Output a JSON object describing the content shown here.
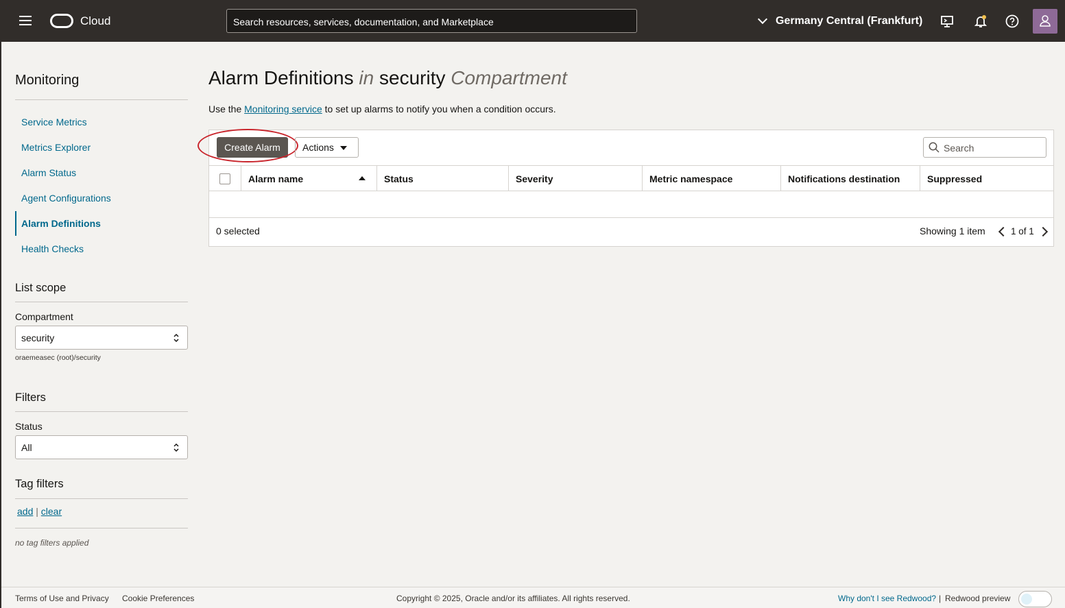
{
  "header": {
    "brand": "Cloud",
    "search_placeholder": "Search resources, services, documentation, and Marketplace",
    "region": "Germany Central (Frankfurt)"
  },
  "sidebar": {
    "title": "Monitoring",
    "items": [
      {
        "label": "Service Metrics"
      },
      {
        "label": "Metrics Explorer"
      },
      {
        "label": "Alarm Status"
      },
      {
        "label": "Agent Configurations"
      },
      {
        "label": "Alarm Definitions",
        "active": true
      },
      {
        "label": "Health Checks"
      }
    ],
    "list_scope": {
      "title": "List scope",
      "compartment_label": "Compartment",
      "compartment_value": "security",
      "compartment_path": "oraemeasec (root)/security"
    },
    "filters": {
      "title": "Filters",
      "status_label": "Status",
      "status_value": "All"
    },
    "tag_filters": {
      "title": "Tag filters",
      "add": "add",
      "sep": "|",
      "clear": "clear",
      "empty": "no tag filters applied"
    }
  },
  "main": {
    "title_part1": "Alarm Definitions",
    "title_in": "in",
    "title_part2": "security",
    "title_part3": "Compartment",
    "desc_prefix": "Use the",
    "desc_link": "Monitoring service",
    "desc_suffix": "to set up alarms to notify you when a condition occurs.",
    "create_button": "Create Alarm",
    "actions_button": "Actions",
    "search_placeholder": "Search",
    "columns": [
      "Alarm name",
      "Status",
      "Severity",
      "Metric namespace",
      "Notifications destination",
      "Suppressed"
    ],
    "rows": [],
    "selected_text": "0 selected",
    "showing_text": "Showing 1 item",
    "page_text": "1 of 1"
  },
  "footer": {
    "terms": "Terms of Use and Privacy",
    "cookies": "Cookie Preferences",
    "copyright": "Copyright © 2025, Oracle and/or its affiliates. All rights reserved.",
    "redwood_link": "Why don't I see Redwood?",
    "sep": "|",
    "redwood_preview": "Redwood preview"
  },
  "colors": {
    "topbar": "#312d2a",
    "link": "#00688c",
    "primary_button": "#5b5651",
    "highlight_circle": "#c9252c",
    "avatar": "#8e6a97"
  }
}
